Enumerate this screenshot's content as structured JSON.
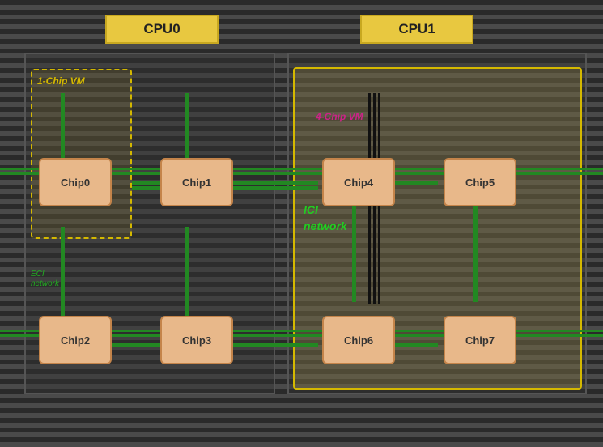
{
  "cpu0": {
    "label": "CPU0"
  },
  "cpu1": {
    "label": "CPU1"
  },
  "vm": {
    "label": "1-Chip VM"
  },
  "chips": {
    "chip0": "Chip0",
    "chip1": "Chip1",
    "chip2": "Chip2",
    "chip3": "Chip3",
    "chip4": "Chip4",
    "chip5": "Chip5",
    "chip6": "Chip6",
    "chip7": "Chip7"
  },
  "ici_label": "ICI\nnetwork",
  "chips_annotation": "4-Chip VM",
  "colors": {
    "accent_yellow": "#e8c840",
    "chip_fill": "#e8b88a",
    "green_line": "#228822",
    "magenta": "#cc2288"
  }
}
